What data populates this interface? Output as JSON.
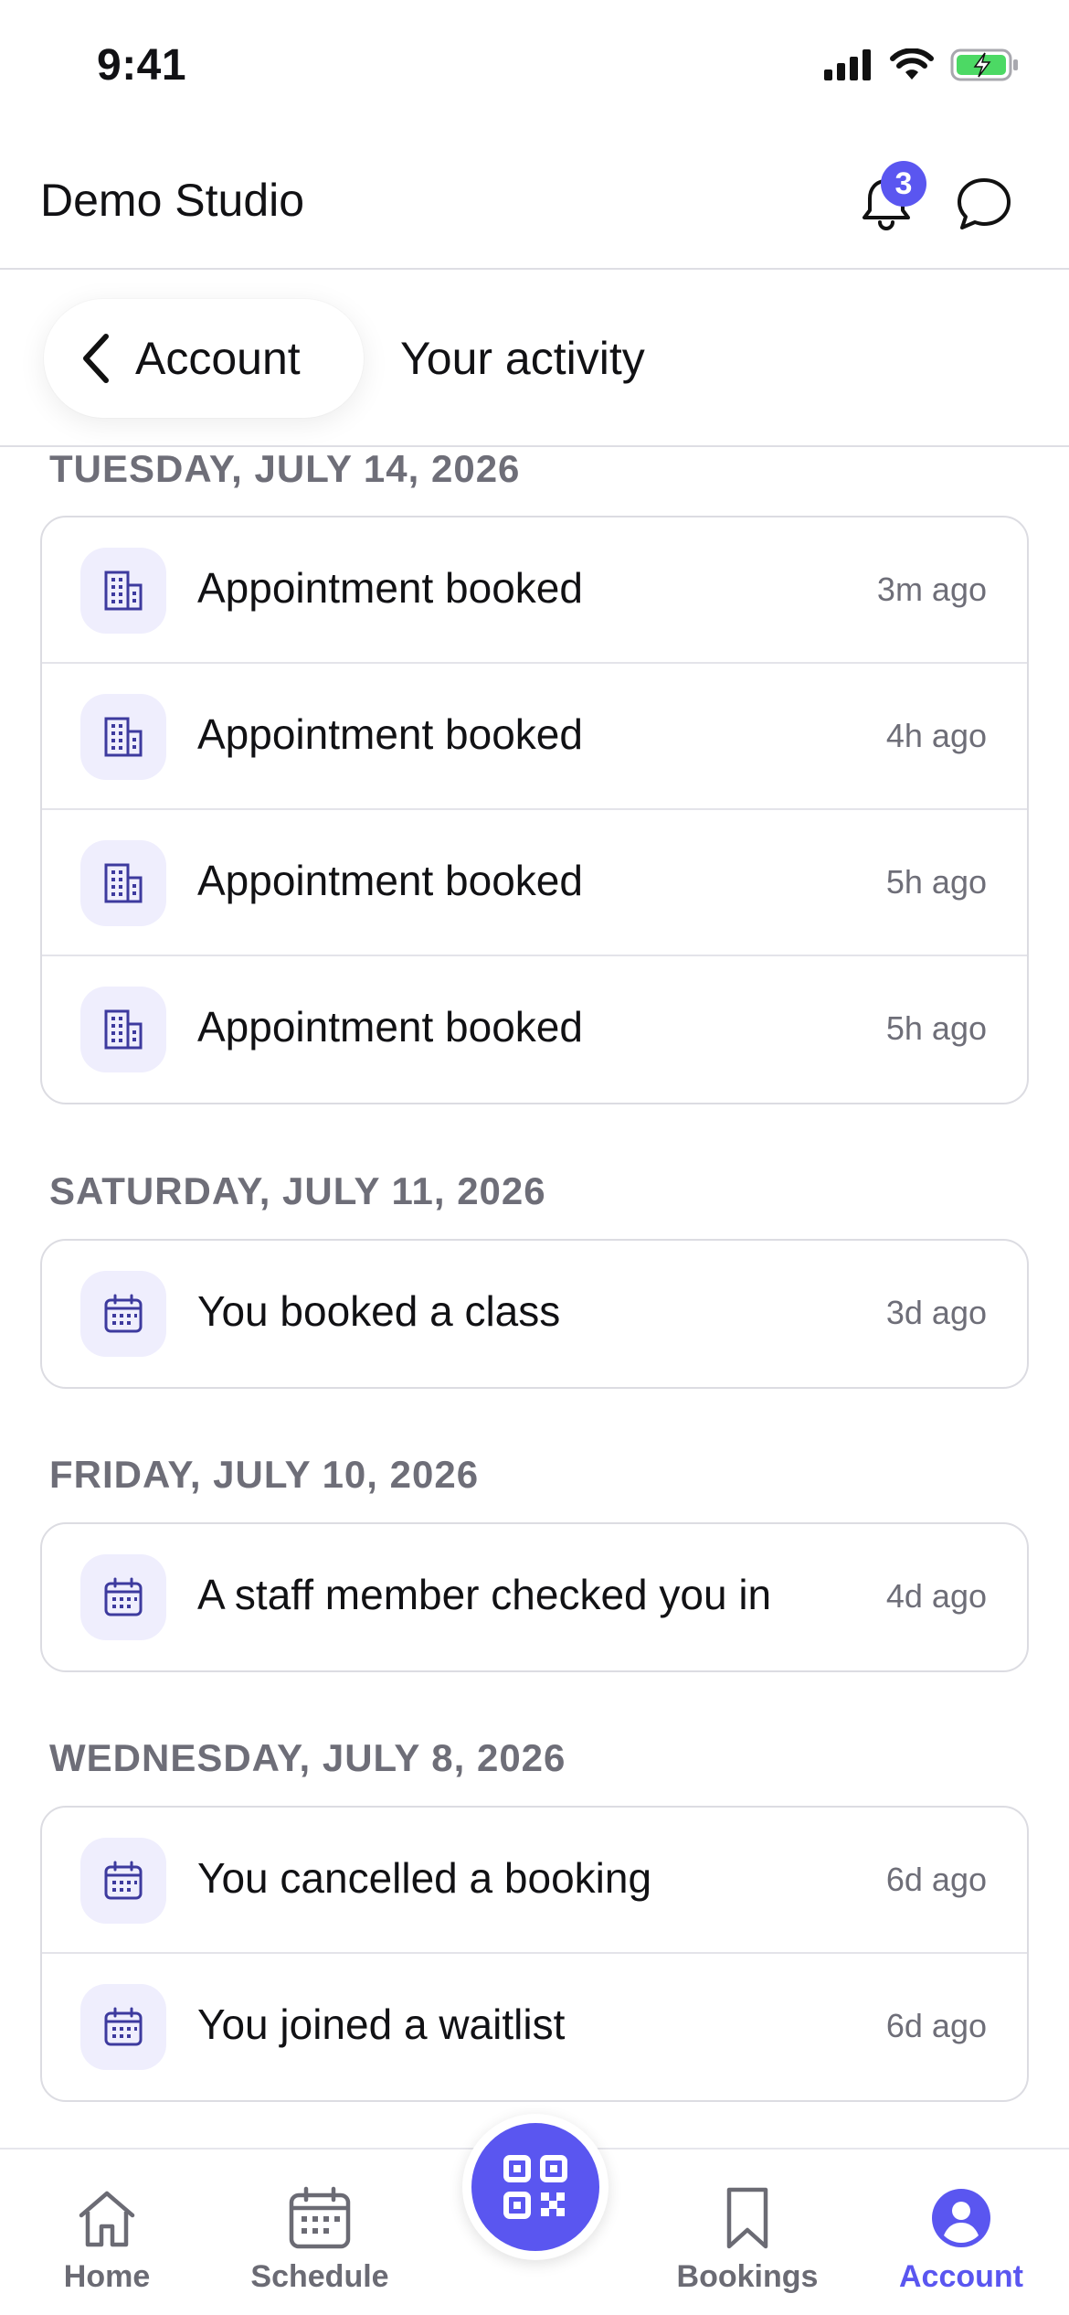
{
  "status_bar": {
    "time": "9:41"
  },
  "header": {
    "title": "Demo Studio",
    "notification_count": "3"
  },
  "subheader": {
    "back_label": "Account",
    "title": "Your activity"
  },
  "activity": {
    "groups": [
      {
        "date": "TUESDAY, JULY 14, 2026",
        "items": [
          {
            "icon": "building-icon",
            "label": "Appointment booked",
            "time": "3m ago"
          },
          {
            "icon": "building-icon",
            "label": "Appointment booked",
            "time": "4h ago"
          },
          {
            "icon": "building-icon",
            "label": "Appointment booked",
            "time": "5h ago"
          },
          {
            "icon": "building-icon",
            "label": "Appointment booked",
            "time": "5h ago"
          }
        ]
      },
      {
        "date": "SATURDAY, JULY 11, 2026",
        "items": [
          {
            "icon": "calendar-icon",
            "label": "You booked a class",
            "time": "3d ago"
          }
        ]
      },
      {
        "date": "FRIDAY, JULY 10, 2026",
        "items": [
          {
            "icon": "calendar-icon",
            "label": "A staff member checked you in",
            "time": "4d ago"
          }
        ]
      },
      {
        "date": "WEDNESDAY, JULY 8, 2026",
        "items": [
          {
            "icon": "calendar-icon",
            "label": "You cancelled a booking",
            "time": "6d ago"
          },
          {
            "icon": "calendar-icon",
            "label": "You joined a waitlist",
            "time": "6d ago"
          }
        ]
      }
    ]
  },
  "tab_bar": {
    "home": "Home",
    "schedule": "Schedule",
    "bookings": "Bookings",
    "account": "Account",
    "active": "account"
  },
  "colors": {
    "accent": "#5a56f0",
    "icon_bg": "#efeefd",
    "muted": "#6e6e78"
  }
}
